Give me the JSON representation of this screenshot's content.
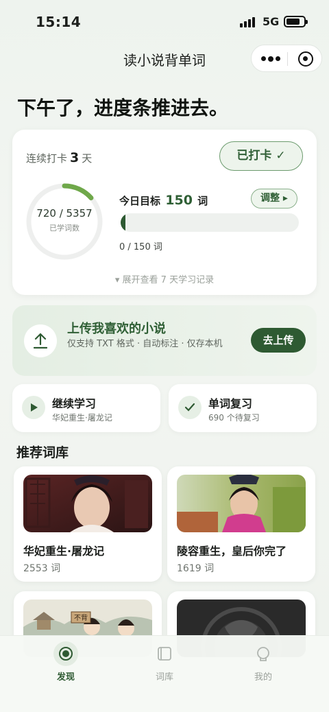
{
  "status_bar": {
    "time": "15:14",
    "network": "5G"
  },
  "nav": {
    "title": "读小说背单词"
  },
  "greeting": "下午了，进度条推进去。",
  "checkin": {
    "streak_prefix": "连续打卡",
    "streak_days": "3",
    "streak_suffix": "天",
    "checked_label": "已打卡 ✓"
  },
  "progress": {
    "learned_text": "720 / 5357",
    "learned_label": "已学词数",
    "learned": 720,
    "total": 5357,
    "goal_prefix": "今日目标",
    "goal_value": "150",
    "goal_suffix": "词",
    "adjust_label": "调整 ▸",
    "today_count": "0 / 150 词",
    "today_fraction": 0.0,
    "expand_label": "▾ 展开查看 7 天学习记录"
  },
  "upload": {
    "title": "上传我喜欢的小说",
    "desc": "仅支持 TXT 格式 · 自动标注 · 仅存本机",
    "button": "去上传"
  },
  "quick": [
    {
      "title": "继续学习",
      "sub": "华妃重生·屠龙记",
      "icon": "play-icon"
    },
    {
      "title": "单词复习",
      "sub": "690 个待复习",
      "icon": "check-icon"
    }
  ],
  "section_title": "推荐词库",
  "books": [
    {
      "title": "华妃重生·屠龙记",
      "count": "2553 词"
    },
    {
      "title": "陵容重生，皇后你完了",
      "count": "1619 词"
    },
    {
      "sign": "不背"
    },
    {}
  ],
  "tabs": [
    {
      "label": "发现",
      "active": true,
      "icon": "discover-icon"
    },
    {
      "label": "词库",
      "active": false,
      "icon": "library-icon"
    },
    {
      "label": "我的",
      "active": false,
      "icon": "profile-icon"
    }
  ],
  "colors": {
    "primary": "#2e5a32",
    "accent": "#6fa84a",
    "background": "#eef3ee"
  }
}
